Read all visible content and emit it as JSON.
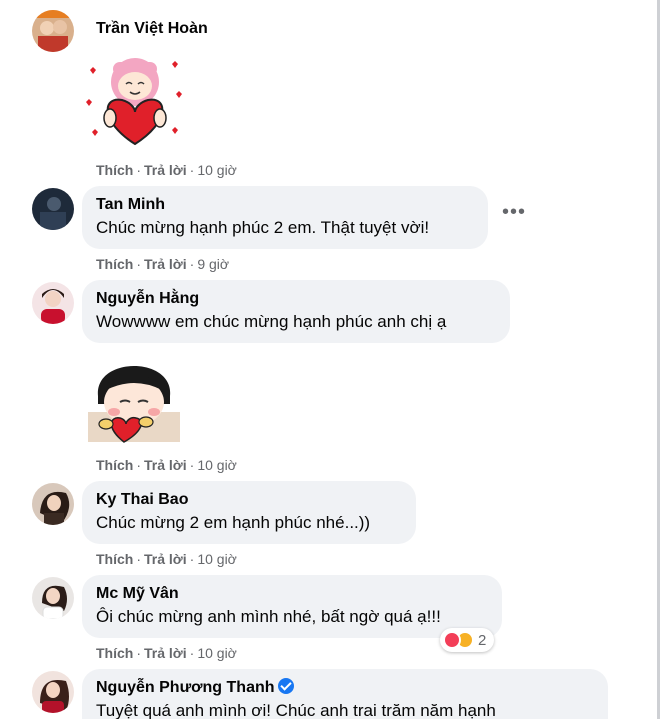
{
  "actions": {
    "like": "Thích",
    "reply": "Trả lời",
    "dot": "·"
  },
  "comments": [
    {
      "name": "Trần Việt Hoàn",
      "text": "",
      "time": "10 giờ",
      "sticker": "heart-hug-girl-sticker"
    },
    {
      "name": "Tan Minh",
      "text": "Chúc mừng hạnh phúc 2 em. Thật tuyệt vời!",
      "time": "9 giờ"
    },
    {
      "name": "Nguyễn Hằng",
      "text": "Wowwww em chúc mừng hạnh phúc anh chị ạ",
      "time": "10 giờ",
      "sticker": "shy-girl-heart-sticker"
    },
    {
      "name": "Ky Thai Bao",
      "text": "Chúc mừng 2 em hạnh phúc nhé...))",
      "time": "10 giờ"
    },
    {
      "name": "Mc Mỹ Vân",
      "text": "Ôi chúc mừng anh mình nhé, bất ngờ quá ạ!!!",
      "time": "10 giờ",
      "reactions": {
        "icons": [
          "heart-reaction-icon",
          "care-reaction-icon"
        ],
        "count": "2"
      }
    },
    {
      "name": "Nguyễn Phương Thanh",
      "text": "Tuyệt quá anh mình ơi! Chúc anh trai trăm năm hạnh",
      "verified": true
    }
  ],
  "more_options": "•••",
  "colors": {
    "bubble": "#f0f2f5",
    "meta": "#65676b",
    "verified": "#1877f2",
    "heart": "#f33e58"
  }
}
